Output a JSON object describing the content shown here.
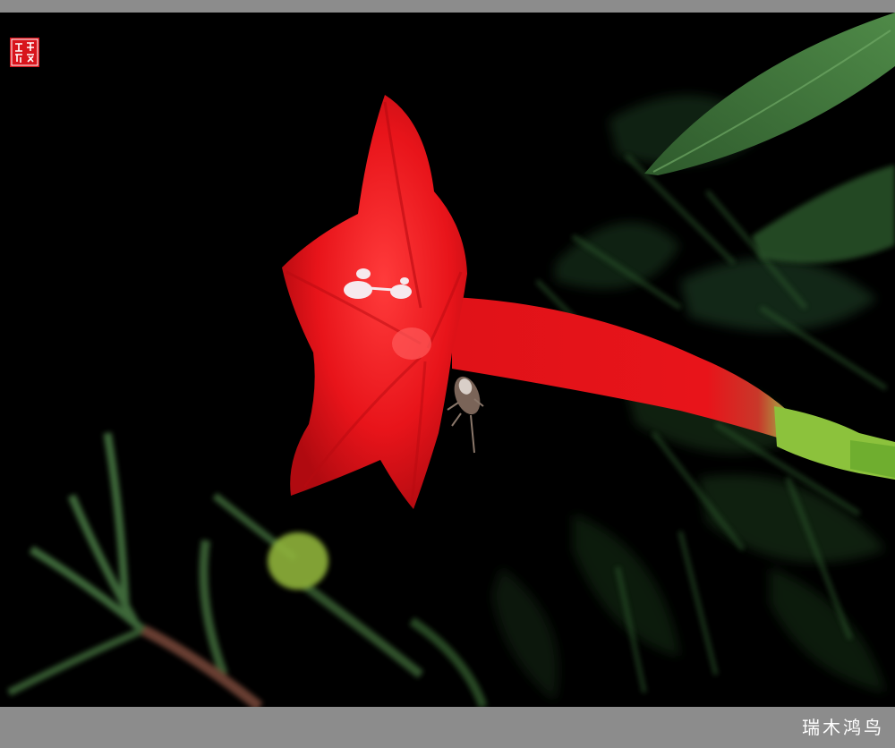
{
  "photo": {
    "subject": "red-star-shaped-flower",
    "seal_text": "瑞木鸿鸟",
    "signature": "瑞木鸿鸟"
  },
  "colors": {
    "frame": "#8c8c8c",
    "background": "#000000",
    "petal": "#e8141a",
    "petal_shadow": "#b00a10",
    "leaf": "#3d6b3a",
    "seal": "#d8141c"
  }
}
